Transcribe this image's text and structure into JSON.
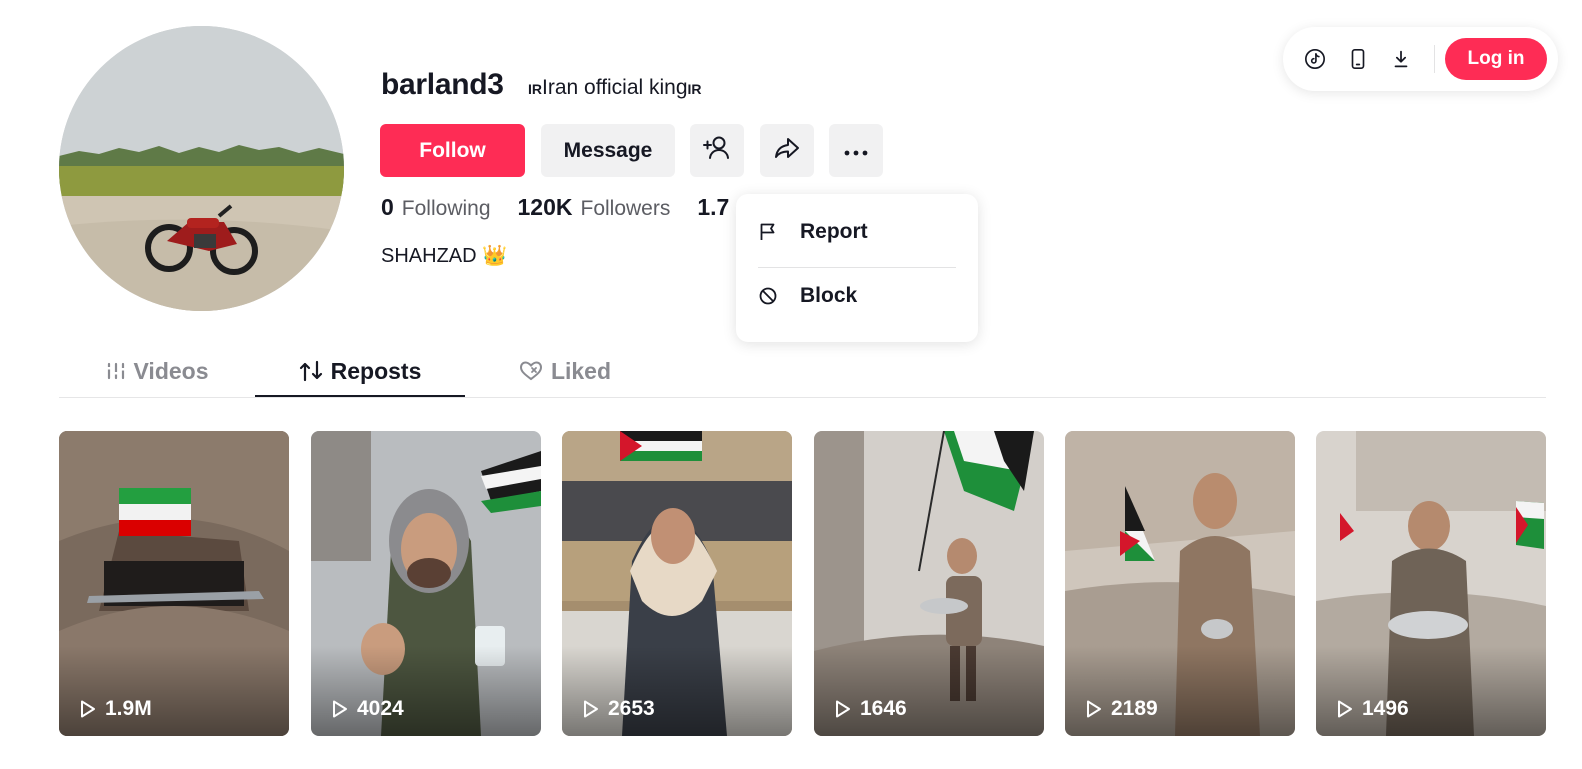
{
  "topbar": {
    "icons": [
      "tiktok-icon",
      "mobile-icon",
      "download-icon"
    ],
    "login_label": "Log in"
  },
  "profile": {
    "username": "barland3",
    "nickname_prefix": "IR",
    "nickname_text": "Iran official king",
    "nickname_suffix": "IR",
    "follow_label": "Follow",
    "message_label": "Message",
    "bio": "SHAHZAD 👑"
  },
  "stats": [
    {
      "value": "0",
      "label": "Following"
    },
    {
      "value": "120K",
      "label": "Followers"
    },
    {
      "value": "1.7",
      "label": ""
    }
  ],
  "dropdown": {
    "items": [
      {
        "label": "Report",
        "icon": "flag-icon"
      },
      {
        "label": "Block",
        "icon": "block-icon"
      }
    ]
  },
  "tabs": [
    {
      "label": "Videos",
      "icon": "videos-icon"
    },
    {
      "label": "Reposts",
      "icon": "repost-icon",
      "active": true
    },
    {
      "label": "Liked",
      "icon": "liked-icon"
    }
  ],
  "videos": [
    {
      "views": "1.9M"
    },
    {
      "views": "4024"
    },
    {
      "views": "2653"
    },
    {
      "views": "1646"
    },
    {
      "views": "2189"
    },
    {
      "views": "1496"
    }
  ],
  "colors": {
    "accent": "#fe2c55",
    "text": "#161823",
    "muted": "#5c5d63",
    "button_bg": "#f1f1f2"
  }
}
